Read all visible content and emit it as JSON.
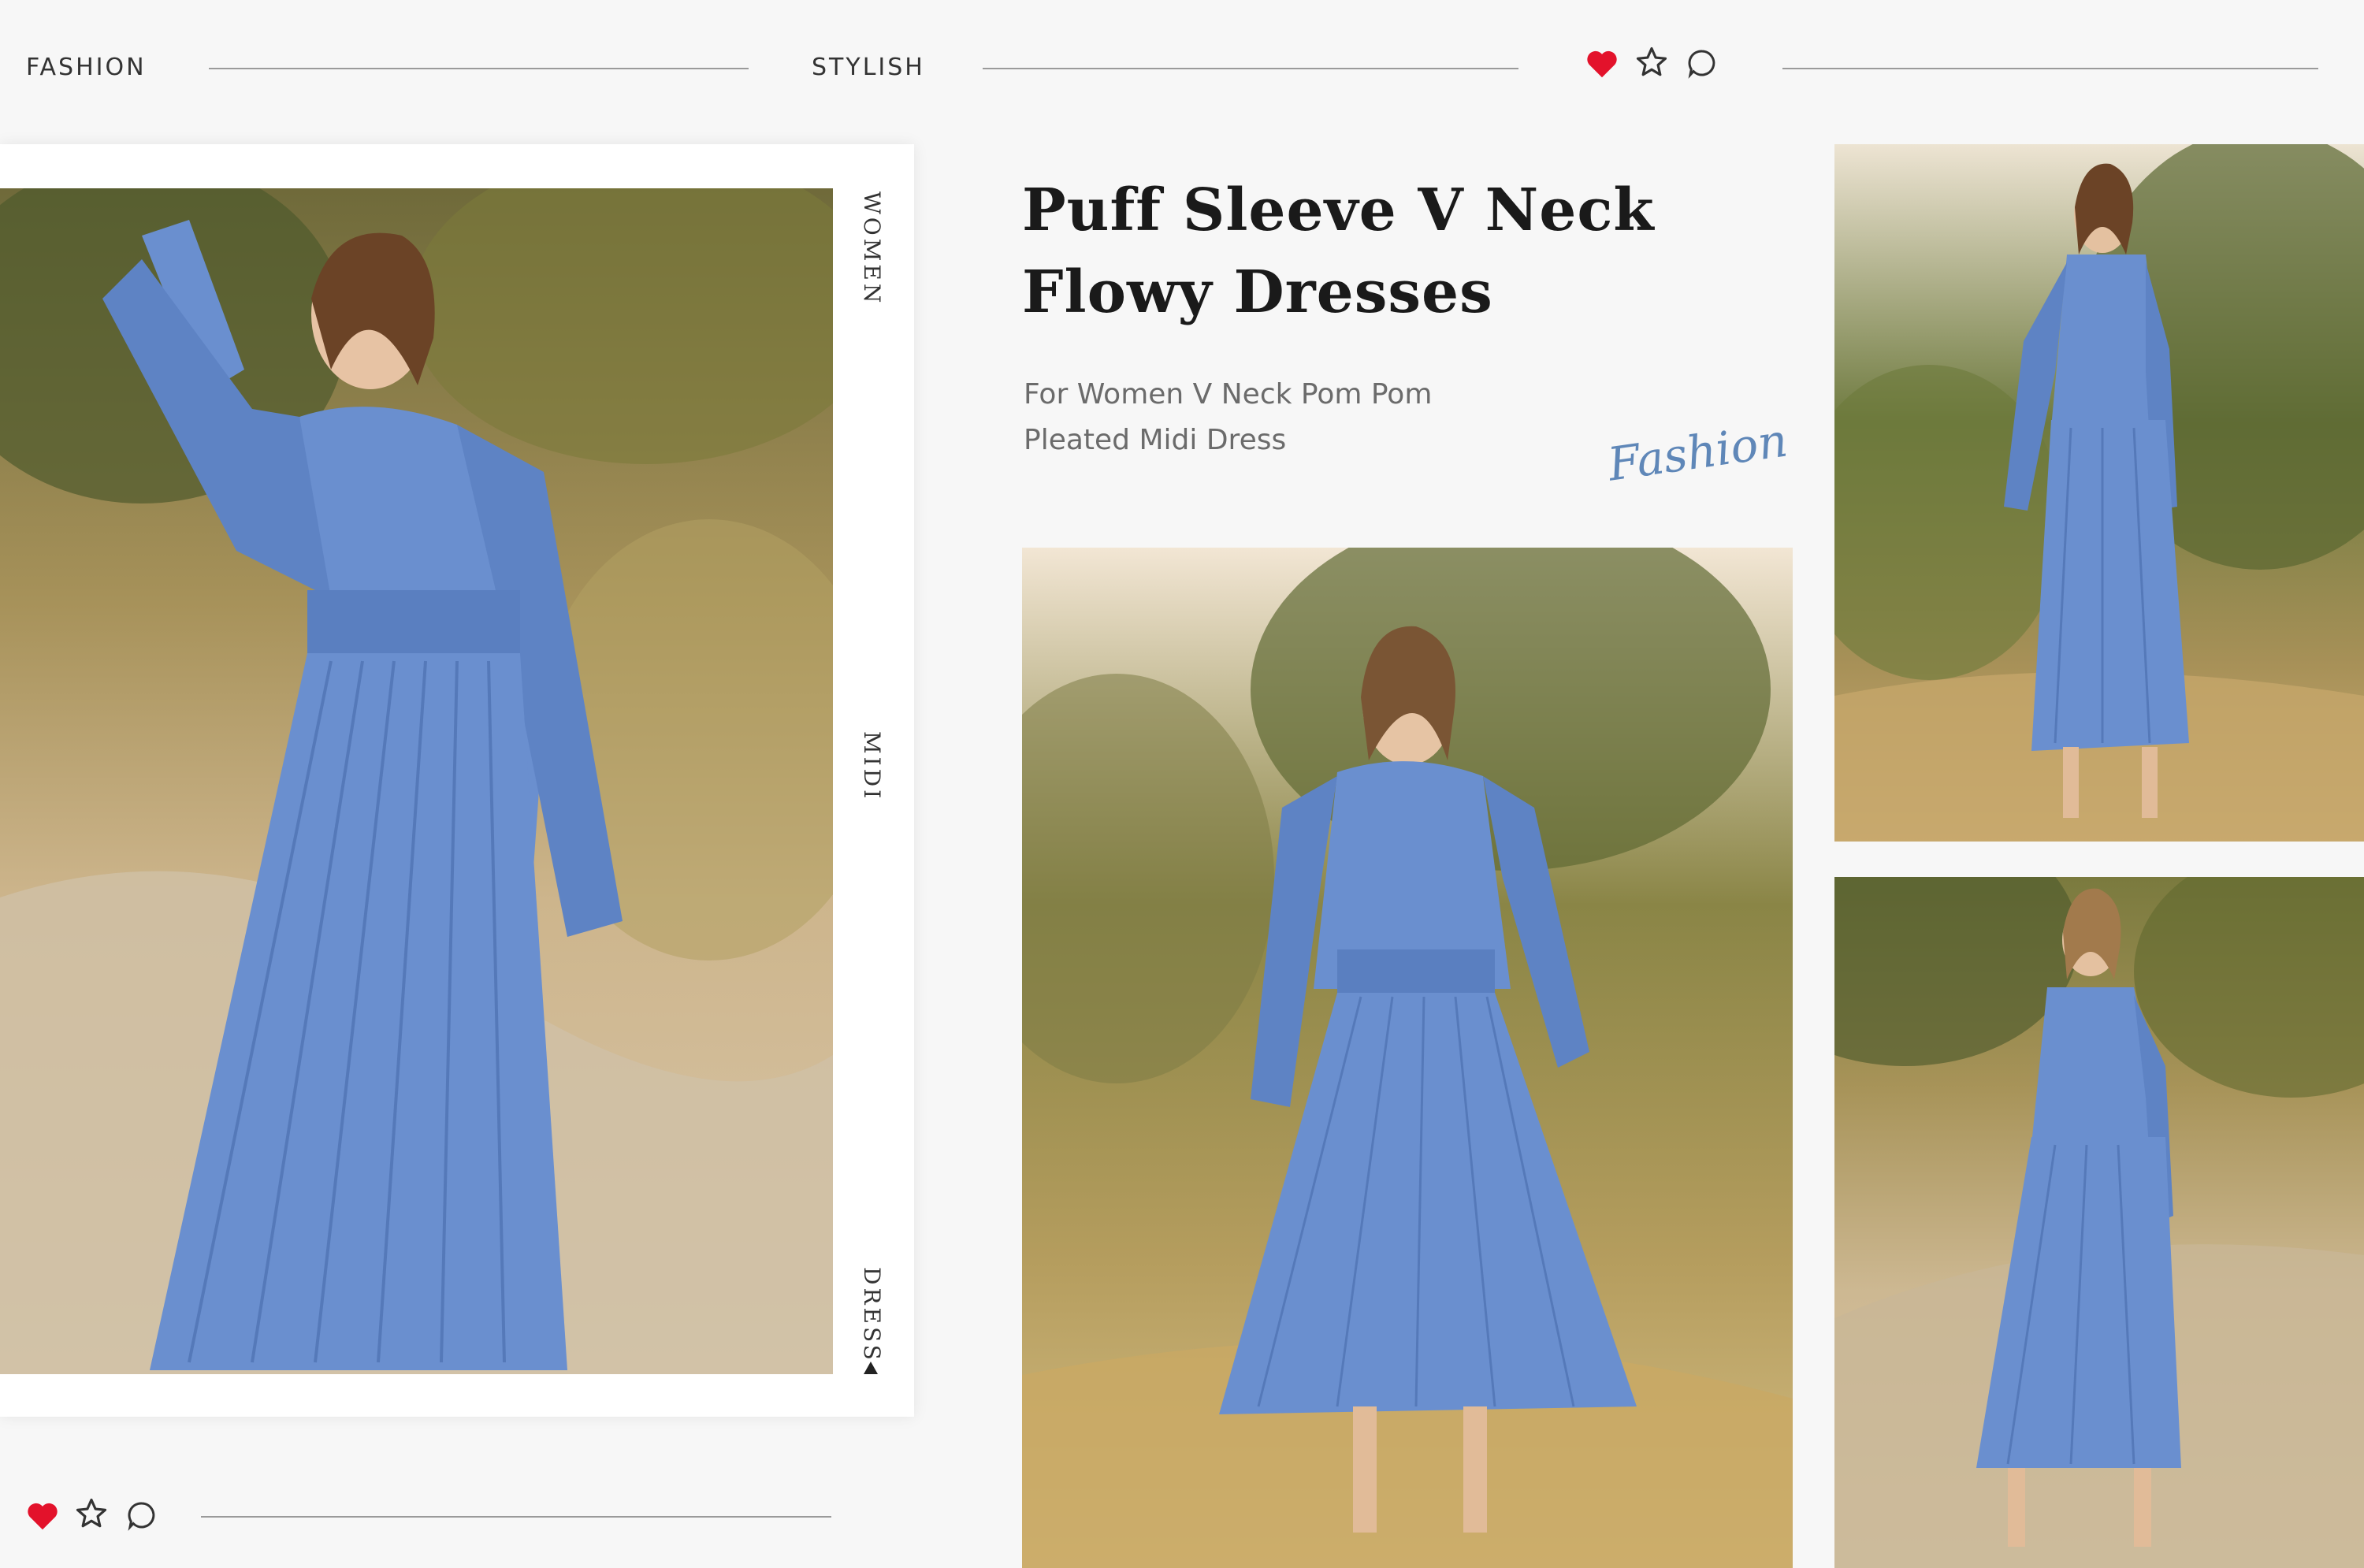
{
  "header": {
    "nav_left": "FASHION",
    "nav_mid": "STYLISH",
    "icons": [
      "heart-icon",
      "star-icon",
      "comment-icon"
    ]
  },
  "left_card": {
    "side_labels": [
      "WOMEN",
      "MIDI",
      "DRESS"
    ],
    "footer_icons": [
      "heart-icon",
      "star-icon",
      "comment-icon"
    ]
  },
  "product": {
    "title_line1": "Puff Sleeve V Neck",
    "title_line2": "Flowy Dresses",
    "subtitle_line1": "For Women V Neck Pom Pom",
    "subtitle_line2": "Pleated Midi Dress",
    "script_word": "Fashion"
  },
  "colors": {
    "heart": "#e3122b",
    "dress": "#6a8fcf",
    "background": "#f7f7f7"
  }
}
